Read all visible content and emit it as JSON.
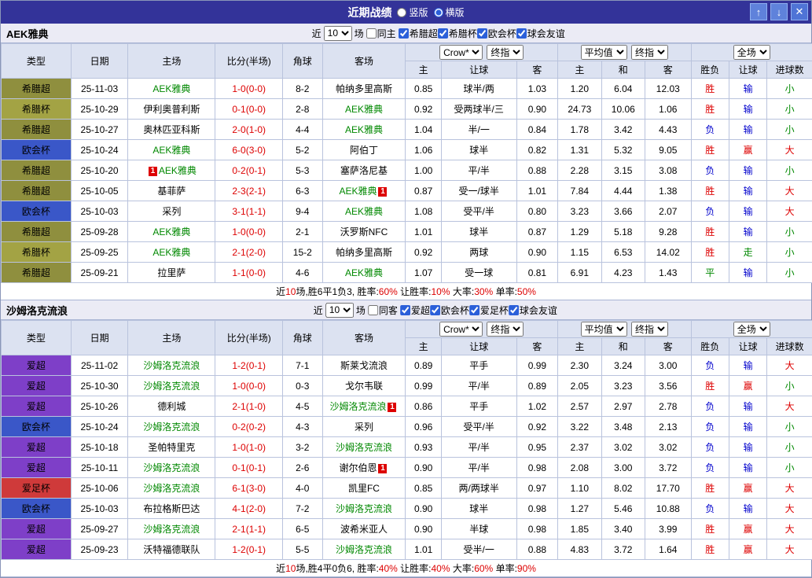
{
  "colors": {
    "leagues": {
      "希腊超": "#8f8f3e",
      "希腊杯": "#a3a344",
      "欧会杯": "#3a57c8",
      "爱超": "#7e3fc8",
      "爱足杯": "#cf3a3a"
    },
    "results": {
      "胜": "#dd0000",
      "负": "#0000cc",
      "平": "#008800",
      "赢": "#dd0000",
      "输": "#0000cc",
      "走": "#008800",
      "大": "#dd0000",
      "小": "#008800"
    },
    "focus_team": "#008800",
    "score": "#dd0000",
    "titlebar_bg": "#333399"
  },
  "title_bar": {
    "title": "近期战绩",
    "layout_options": [
      {
        "label": "竖版",
        "checked": false
      },
      {
        "label": "横版",
        "checked": true
      }
    ],
    "up_icon": "↑",
    "down_icon": "↓",
    "close_icon": "✕"
  },
  "sections": [
    {
      "team": "AEK雅典",
      "filter": {
        "near": "近",
        "count": "10",
        "games": "场",
        "same": "同主",
        "same_checked": false,
        "leagues": [
          {
            "label": "希腊超",
            "checked": true
          },
          {
            "label": "希腊杯",
            "checked": true
          },
          {
            "label": "欧会杯",
            "checked": true
          },
          {
            "label": "球会友谊",
            "checked": true
          }
        ]
      },
      "header": {
        "cols": {
          "type": "类型",
          "date": "日期",
          "home": "主场",
          "score": "比分(半场)",
          "corner": "角球",
          "away": "客场"
        },
        "odds1": {
          "select1": "Crow*",
          "select2": "终指",
          "cols": [
            "主",
            "让球",
            "客"
          ]
        },
        "odds2": {
          "select1": "平均值",
          "select2": "终指",
          "cols": [
            "主",
            "和",
            "客"
          ]
        },
        "result": {
          "select": "全场",
          "cols": [
            "胜负",
            "让球",
            "进球数"
          ]
        }
      },
      "rows": [
        {
          "type": "希腊超",
          "date": "25-11-03",
          "home": {
            "name": "AEK雅典",
            "focus": true
          },
          "score": "1-0(0-0)",
          "corner": "8-2",
          "away": {
            "name": "帕纳多里高斯",
            "focus": false
          },
          "odds": [
            "0.85",
            "球半/两",
            "1.03",
            "1.20",
            "6.04",
            "12.03"
          ],
          "results": [
            "胜",
            "输",
            "小"
          ]
        },
        {
          "type": "希腊杯",
          "date": "25-10-29",
          "home": {
            "name": "伊利奥普利斯",
            "focus": false
          },
          "score": "0-1(0-0)",
          "corner": "2-8",
          "away": {
            "name": "AEK雅典",
            "focus": true
          },
          "odds": [
            "0.92",
            "受两球半/三",
            "0.90",
            "24.73",
            "10.06",
            "1.06"
          ],
          "results": [
            "胜",
            "输",
            "小"
          ]
        },
        {
          "type": "希腊超",
          "date": "25-10-27",
          "home": {
            "name": "奥林匹亚科斯",
            "focus": false
          },
          "score": "2-0(1-0)",
          "corner": "4-4",
          "away": {
            "name": "AEK雅典",
            "focus": true
          },
          "odds": [
            "1.04",
            "半/一",
            "0.84",
            "1.78",
            "3.42",
            "4.43"
          ],
          "results": [
            "负",
            "输",
            "小"
          ]
        },
        {
          "type": "欧会杯",
          "date": "25-10-24",
          "home": {
            "name": "AEK雅典",
            "focus": true
          },
          "score": "6-0(3-0)",
          "corner": "5-2",
          "away": {
            "name": "阿伯丁",
            "focus": false
          },
          "odds": [
            "1.06",
            "球半",
            "0.82",
            "1.31",
            "5.32",
            "9.05"
          ],
          "results": [
            "胜",
            "赢",
            "大"
          ]
        },
        {
          "type": "希腊超",
          "date": "25-10-20",
          "home": {
            "name": "AEK雅典",
            "focus": true,
            "badge": "1",
            "badge_side": "left"
          },
          "score": "0-2(0-1)",
          "corner": "5-3",
          "away": {
            "name": "塞萨洛尼基",
            "focus": false
          },
          "odds": [
            "1.00",
            "平/半",
            "0.88",
            "2.28",
            "3.15",
            "3.08"
          ],
          "results": [
            "负",
            "输",
            "小"
          ]
        },
        {
          "type": "希腊超",
          "date": "25-10-05",
          "home": {
            "name": "基菲萨",
            "focus": false
          },
          "score": "2-3(2-1)",
          "corner": "6-3",
          "away": {
            "name": "AEK雅典",
            "focus": true,
            "badge": "1",
            "badge_side": "right"
          },
          "odds": [
            "0.87",
            "受一/球半",
            "1.01",
            "7.84",
            "4.44",
            "1.38"
          ],
          "results": [
            "胜",
            "输",
            "大"
          ]
        },
        {
          "type": "欧会杯",
          "date": "25-10-03",
          "home": {
            "name": "采列",
            "focus": false
          },
          "score": "3-1(1-1)",
          "corner": "9-4",
          "away": {
            "name": "AEK雅典",
            "focus": true
          },
          "odds": [
            "1.08",
            "受平/半",
            "0.80",
            "3.23",
            "3.66",
            "2.07"
          ],
          "results": [
            "负",
            "输",
            "大"
          ]
        },
        {
          "type": "希腊超",
          "date": "25-09-28",
          "home": {
            "name": "AEK雅典",
            "focus": true
          },
          "score": "1-0(0-0)",
          "corner": "2-1",
          "away": {
            "name": "沃罗斯NFC",
            "focus": false
          },
          "odds": [
            "1.01",
            "球半",
            "0.87",
            "1.29",
            "5.18",
            "9.28"
          ],
          "results": [
            "胜",
            "输",
            "小"
          ]
        },
        {
          "type": "希腊杯",
          "date": "25-09-25",
          "home": {
            "name": "AEK雅典",
            "focus": true
          },
          "score": "2-1(2-0)",
          "corner": "15-2",
          "away": {
            "name": "帕纳多里高斯",
            "focus": false
          },
          "odds": [
            "0.92",
            "两球",
            "0.90",
            "1.15",
            "6.53",
            "14.02"
          ],
          "results": [
            "胜",
            "走",
            "小"
          ]
        },
        {
          "type": "希腊超",
          "date": "25-09-21",
          "home": {
            "name": "拉里萨",
            "focus": false
          },
          "score": "1-1(0-0)",
          "corner": "4-6",
          "away": {
            "name": "AEK雅典",
            "focus": true
          },
          "odds": [
            "1.07",
            "受一球",
            "0.81",
            "6.91",
            "4.23",
            "1.43"
          ],
          "results": [
            "平",
            "输",
            "小"
          ]
        }
      ],
      "summary": [
        {
          "t": "近",
          "c": "#000000"
        },
        {
          "t": "10",
          "c": "#dd0000"
        },
        {
          "t": "场,胜6平1负3, 胜率:",
          "c": "#000000"
        },
        {
          "t": "60%",
          "c": "#dd0000"
        },
        {
          "t": " 让胜率:",
          "c": "#000000"
        },
        {
          "t": "10%",
          "c": "#dd0000"
        },
        {
          "t": " 大率:",
          "c": "#000000"
        },
        {
          "t": "30%",
          "c": "#dd0000"
        },
        {
          "t": " 单率:",
          "c": "#000000"
        },
        {
          "t": "50%",
          "c": "#dd0000"
        }
      ]
    },
    {
      "team": "沙姆洛克流浪",
      "filter": {
        "near": "近",
        "count": "10",
        "games": "场",
        "same": "同客",
        "same_checked": false,
        "leagues": [
          {
            "label": "爱超",
            "checked": true
          },
          {
            "label": "欧会杯",
            "checked": true
          },
          {
            "label": "爱足杯",
            "checked": true
          },
          {
            "label": "球会友谊",
            "checked": true
          }
        ]
      },
      "header": {
        "cols": {
          "type": "类型",
          "date": "日期",
          "home": "主场",
          "score": "比分(半场)",
          "corner": "角球",
          "away": "客场"
        },
        "odds1": {
          "select1": "Crow*",
          "select2": "终指",
          "cols": [
            "主",
            "让球",
            "客"
          ]
        },
        "odds2": {
          "select1": "平均值",
          "select2": "终指",
          "cols": [
            "主",
            "和",
            "客"
          ]
        },
        "result": {
          "select": "全场",
          "cols": [
            "胜负",
            "让球",
            "进球数"
          ]
        }
      },
      "rows": [
        {
          "type": "爱超",
          "date": "25-11-02",
          "home": {
            "name": "沙姆洛克流浪",
            "focus": true
          },
          "score": "1-2(0-1)",
          "corner": "7-1",
          "away": {
            "name": "斯莱戈流浪",
            "focus": false
          },
          "odds": [
            "0.89",
            "平手",
            "0.99",
            "2.30",
            "3.24",
            "3.00"
          ],
          "results": [
            "负",
            "输",
            "大"
          ]
        },
        {
          "type": "爱超",
          "date": "25-10-30",
          "home": {
            "name": "沙姆洛克流浪",
            "focus": true
          },
          "score": "1-0(0-0)",
          "corner": "0-3",
          "away": {
            "name": "戈尔韦联",
            "focus": false
          },
          "odds": [
            "0.99",
            "平/半",
            "0.89",
            "2.05",
            "3.23",
            "3.56"
          ],
          "results": [
            "胜",
            "赢",
            "小"
          ]
        },
        {
          "type": "爱超",
          "date": "25-10-26",
          "home": {
            "name": "德利城",
            "focus": false
          },
          "score": "2-1(1-0)",
          "corner": "4-5",
          "away": {
            "name": "沙姆洛克流浪",
            "focus": true,
            "badge": "1",
            "badge_side": "right"
          },
          "odds": [
            "0.86",
            "平手",
            "1.02",
            "2.57",
            "2.97",
            "2.78"
          ],
          "results": [
            "负",
            "输",
            "大"
          ]
        },
        {
          "type": "欧会杯",
          "date": "25-10-24",
          "home": {
            "name": "沙姆洛克流浪",
            "focus": true
          },
          "score": "0-2(0-2)",
          "corner": "4-3",
          "away": {
            "name": "采列",
            "focus": false
          },
          "odds": [
            "0.96",
            "受平/半",
            "0.92",
            "3.22",
            "3.48",
            "2.13"
          ],
          "results": [
            "负",
            "输",
            "小"
          ]
        },
        {
          "type": "爱超",
          "date": "25-10-18",
          "home": {
            "name": "圣帕特里克",
            "focus": false
          },
          "score": "1-0(1-0)",
          "corner": "3-2",
          "away": {
            "name": "沙姆洛克流浪",
            "focus": true
          },
          "odds": [
            "0.93",
            "平/半",
            "0.95",
            "2.37",
            "3.02",
            "3.02"
          ],
          "results": [
            "负",
            "输",
            "小"
          ]
        },
        {
          "type": "爱超",
          "date": "25-10-11",
          "home": {
            "name": "沙姆洛克流浪",
            "focus": true
          },
          "score": "0-1(0-1)",
          "corner": "2-6",
          "away": {
            "name": "谢尔伯恩",
            "focus": false,
            "badge": "1",
            "badge_side": "right"
          },
          "odds": [
            "0.90",
            "平/半",
            "0.98",
            "2.08",
            "3.00",
            "3.72"
          ],
          "results": [
            "负",
            "输",
            "小"
          ]
        },
        {
          "type": "爱足杯",
          "date": "25-10-06",
          "home": {
            "name": "沙姆洛克流浪",
            "focus": true
          },
          "score": "6-1(3-0)",
          "corner": "4-0",
          "away": {
            "name": "凯里FC",
            "focus": false
          },
          "odds": [
            "0.85",
            "两/两球半",
            "0.97",
            "1.10",
            "8.02",
            "17.70"
          ],
          "results": [
            "胜",
            "赢",
            "大"
          ]
        },
        {
          "type": "欧会杯",
          "date": "25-10-03",
          "home": {
            "name": "布拉格斯巴达",
            "focus": false
          },
          "score": "4-1(2-0)",
          "corner": "7-2",
          "away": {
            "name": "沙姆洛克流浪",
            "focus": true
          },
          "odds": [
            "0.90",
            "球半",
            "0.98",
            "1.27",
            "5.46",
            "10.88"
          ],
          "results": [
            "负",
            "输",
            "大"
          ]
        },
        {
          "type": "爱超",
          "date": "25-09-27",
          "home": {
            "name": "沙姆洛克流浪",
            "focus": true
          },
          "score": "2-1(1-1)",
          "corner": "6-5",
          "away": {
            "name": "波希米亚人",
            "focus": false
          },
          "odds": [
            "0.90",
            "半球",
            "0.98",
            "1.85",
            "3.40",
            "3.99"
          ],
          "results": [
            "胜",
            "赢",
            "大"
          ]
        },
        {
          "type": "爱超",
          "date": "25-09-23",
          "home": {
            "name": "沃特福德联队",
            "focus": false
          },
          "score": "1-2(0-1)",
          "corner": "5-5",
          "away": {
            "name": "沙姆洛克流浪",
            "focus": true
          },
          "odds": [
            "1.01",
            "受半/一",
            "0.88",
            "4.83",
            "3.72",
            "1.64"
          ],
          "results": [
            "胜",
            "赢",
            "大"
          ]
        }
      ],
      "summary": [
        {
          "t": "近",
          "c": "#000000"
        },
        {
          "t": "10",
          "c": "#dd0000"
        },
        {
          "t": "场,胜4平0负6, 胜率:",
          "c": "#000000"
        },
        {
          "t": "40%",
          "c": "#dd0000"
        },
        {
          "t": " 让胜率:",
          "c": "#000000"
        },
        {
          "t": "40%",
          "c": "#dd0000"
        },
        {
          "t": " 大率:",
          "c": "#000000"
        },
        {
          "t": "60%",
          "c": "#dd0000"
        },
        {
          "t": " 单率:",
          "c": "#000000"
        },
        {
          "t": "90%",
          "c": "#dd0000"
        }
      ]
    }
  ]
}
